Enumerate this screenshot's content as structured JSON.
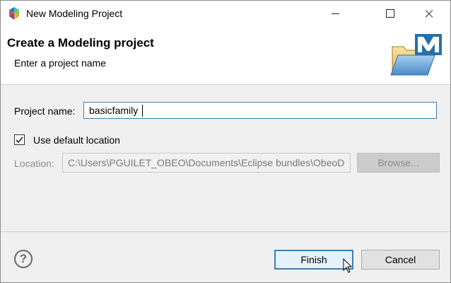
{
  "window": {
    "title": "New Modeling Project"
  },
  "banner": {
    "title": "Create a Modeling project",
    "subtitle": "Enter a project name"
  },
  "form": {
    "project_name_label": "Project name:",
    "project_name_value": "basicfamily",
    "use_default_location_label": "Use default location",
    "use_default_location_checked": true,
    "location_label": "Location:",
    "location_value": "C:\\Users\\PGUILET_OBEO\\Documents\\Eclipse bundles\\ObeoD",
    "browse_label": "Browse..."
  },
  "footer": {
    "help_symbol": "?",
    "finish_label": "Finish",
    "cancel_label": "Cancel"
  },
  "icons": {
    "app": "modeling-app-icon",
    "banner": "modeling-project-folder-icon",
    "help": "help-icon"
  },
  "colors": {
    "focus_border": "#3c7fb1",
    "default_button_bg": "#e5f1fb"
  }
}
